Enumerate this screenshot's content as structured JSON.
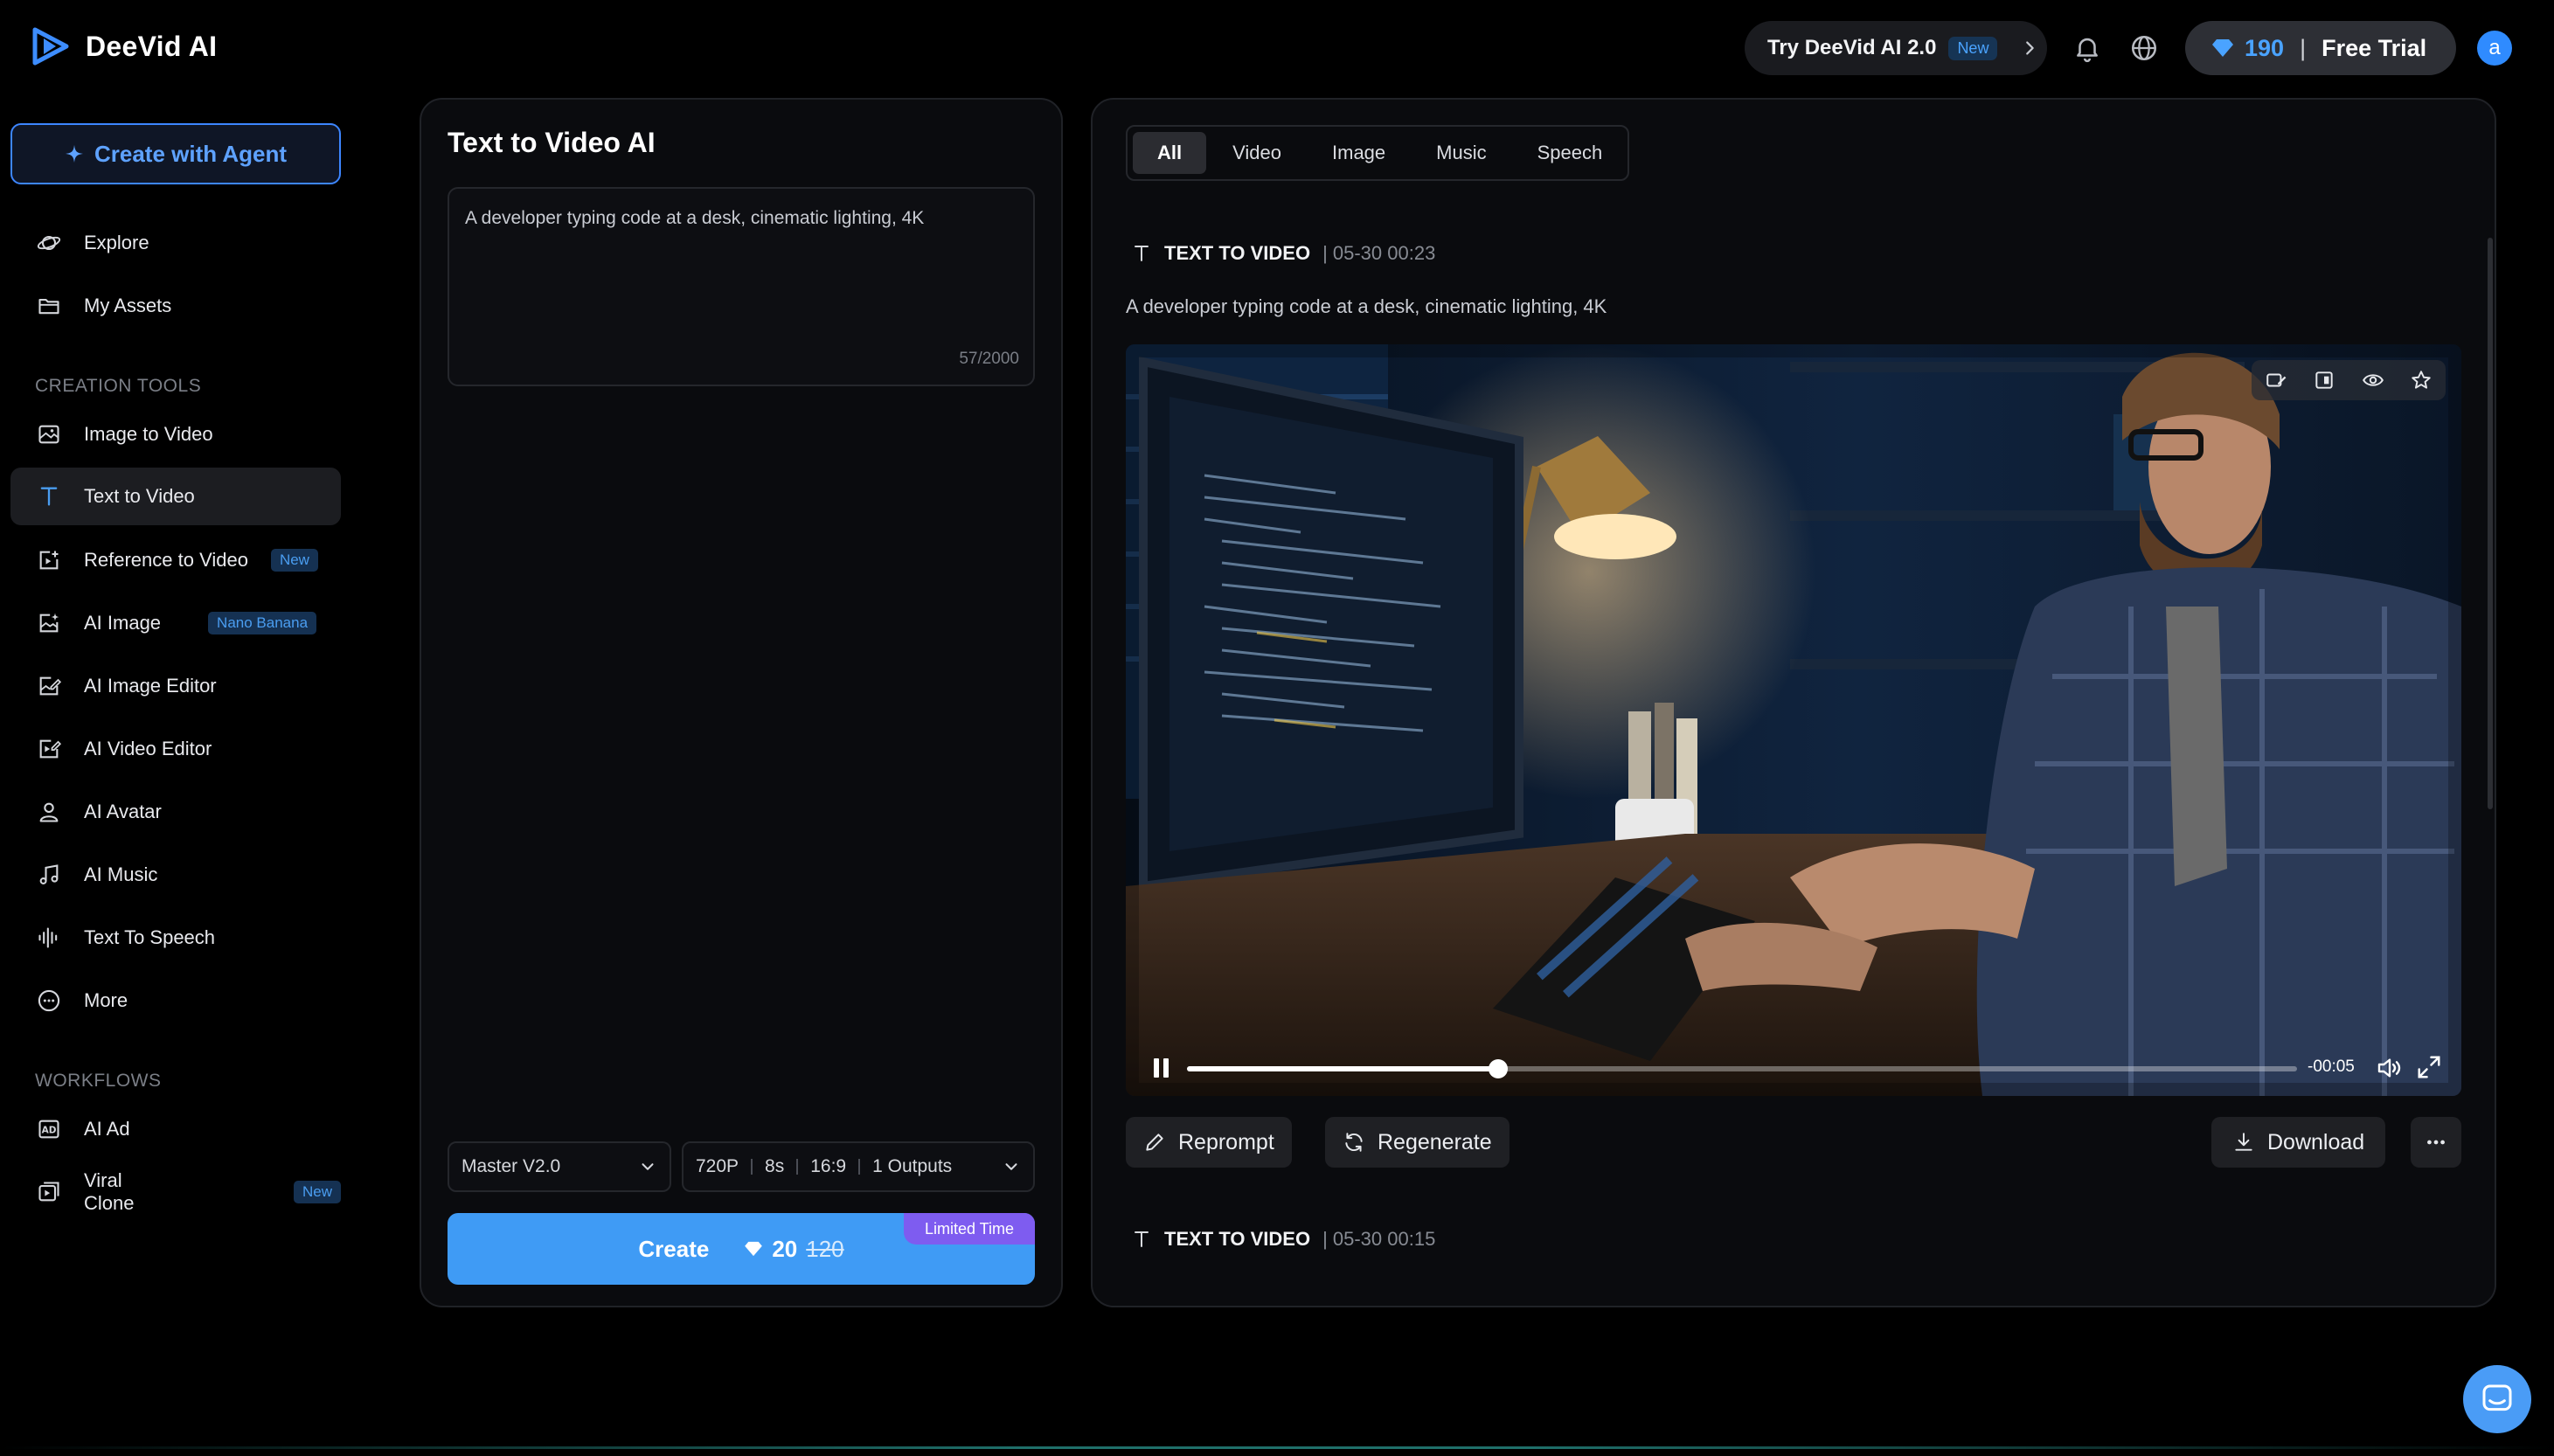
{
  "header": {
    "brand": "DeeVid AI",
    "try_pill": {
      "label": "Try DeeVid AI 2.0",
      "badge": "New",
      "chevron": "chevron-right-icon"
    },
    "icons": [
      "bell-icon",
      "globe-icon"
    ],
    "credits": {
      "icon": "diamond-icon",
      "amount": "190",
      "separator": "|",
      "plan": "Free Trial"
    },
    "avatar_initial": "a"
  },
  "sidebar": {
    "agent_button": {
      "icon": "sparkle-icon",
      "label": "Create with Agent"
    },
    "top_items": [
      {
        "label": "Explore",
        "icon": "planet-icon"
      },
      {
        "label": "My Assets",
        "icon": "folder-icon"
      }
    ],
    "creation_tools_label": "CREATION TOOLS",
    "creation_tools": [
      {
        "label": "Image to Video",
        "icon": "image-icon"
      },
      {
        "label": "Text to Video",
        "icon": "text-icon",
        "active": true
      },
      {
        "label": "Reference to Video",
        "icon": "reference-icon",
        "badge": "New"
      },
      {
        "label": "AI Image",
        "icon": "ai-image-icon",
        "badge": "Nano Banana"
      },
      {
        "label": "AI Image Editor",
        "icon": "image-edit-icon"
      },
      {
        "label": "AI Video Editor",
        "icon": "video-edit-icon"
      },
      {
        "label": "AI Avatar",
        "icon": "person-icon"
      },
      {
        "label": "AI Music",
        "icon": "music-note-icon"
      },
      {
        "label": "Text To Speech",
        "icon": "waveform-icon"
      },
      {
        "label": "More",
        "icon": "more-circle-icon"
      }
    ],
    "workflows_label": "WORKFLOWS",
    "workflows": [
      {
        "label": "AI Ad",
        "icon": "ad-icon"
      },
      {
        "label": "Viral Clone",
        "icon": "clone-icon",
        "badge": "New"
      }
    ]
  },
  "generator": {
    "title": "Text to Video AI",
    "prompt_value": "A developer typing code at a desk, cinematic lighting, 4K",
    "char_count": "57/2000",
    "model_select": "Master V2.0",
    "options": [
      "720P",
      "8s",
      "16:9",
      "1 Outputs"
    ],
    "create_label": "Create",
    "cost": "20",
    "old_cost": "120",
    "promo_badge": "Limited Time"
  },
  "results": {
    "tabs": [
      "All",
      "Video",
      "Image",
      "Music",
      "Speech"
    ],
    "active_tab": "All",
    "entries": [
      {
        "type": "TEXT TO VIDEO",
        "time": "| 05-30 00:23",
        "prompt": "A developer typing code at a desk, cinematic lighting, 4K",
        "player": {
          "time_remaining": "-00:05",
          "progress": 0.28,
          "state": "playing"
        },
        "actions": {
          "reprompt": "Reprompt",
          "regenerate": "Regenerate",
          "download": "Download"
        }
      },
      {
        "type": "TEXT TO VIDEO",
        "time": "| 05-30 00:15"
      }
    ]
  },
  "colors": {
    "accent": "#3f9bf5",
    "promo": "#7e5cf0",
    "badge_text": "#4a9df0",
    "panel_bg": "#0a0b0e"
  }
}
